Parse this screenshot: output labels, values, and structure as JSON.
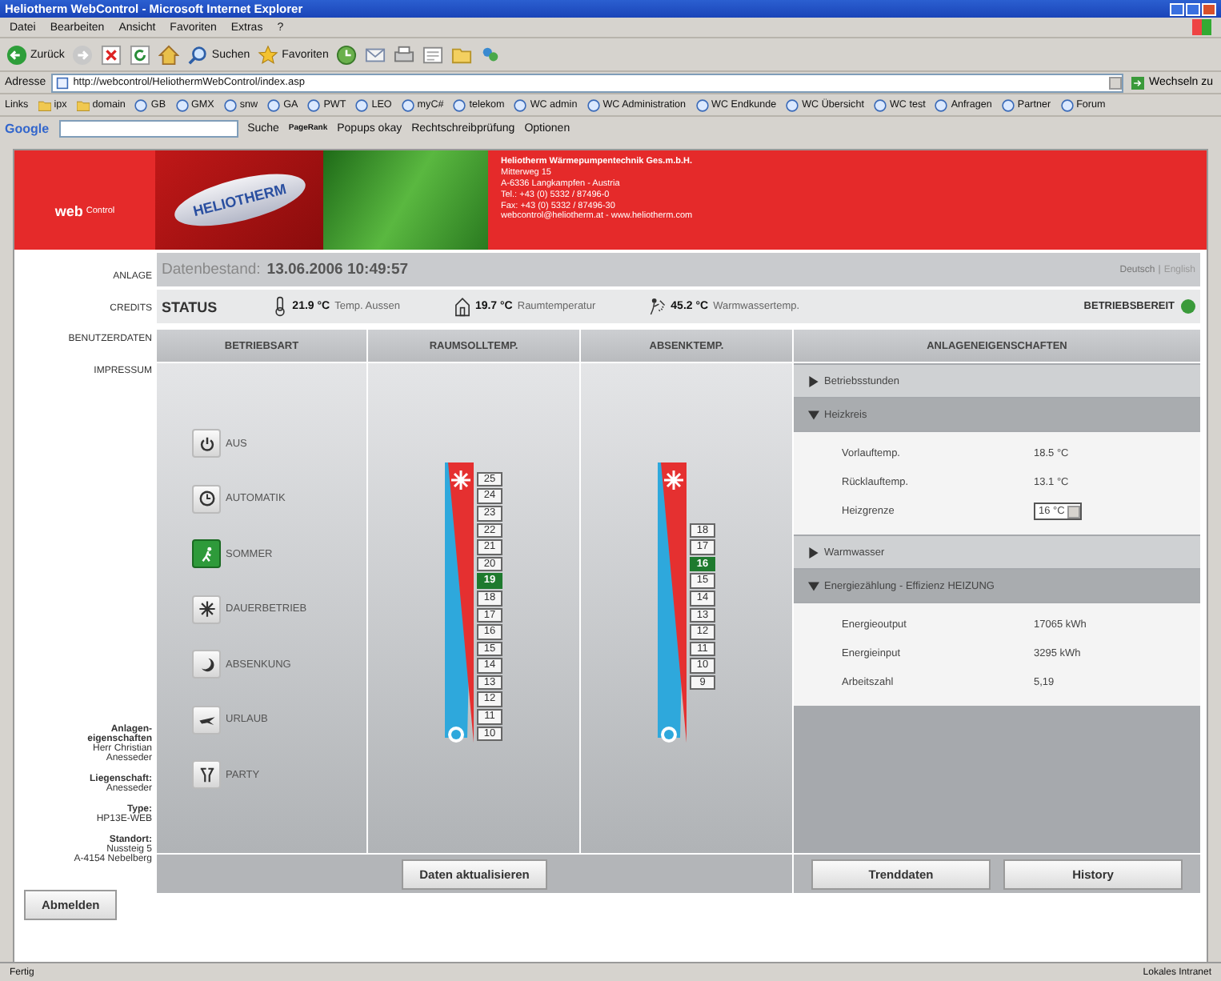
{
  "window": {
    "title": "Heliotherm WebControl - Microsoft Internet Explorer"
  },
  "menu": [
    "Datei",
    "Bearbeiten",
    "Ansicht",
    "Favoriten",
    "Extras",
    "?"
  ],
  "toolbar": {
    "back": "Zurück",
    "search": "Suchen",
    "favorites": "Favoriten"
  },
  "address": {
    "label": "Adresse",
    "url": "http://webcontrol/HeliothermWebControl/index.asp",
    "go": "Wechseln zu"
  },
  "links": {
    "label": "Links",
    "items": [
      {
        "label": "ipx",
        "kind": "folder"
      },
      {
        "label": "domain",
        "kind": "folder"
      },
      {
        "label": "GB",
        "kind": "page"
      },
      {
        "label": "GMX",
        "kind": "page"
      },
      {
        "label": "snw",
        "kind": "page"
      },
      {
        "label": "GA",
        "kind": "page"
      },
      {
        "label": "PWT",
        "kind": "page"
      },
      {
        "label": "LEO",
        "kind": "page"
      },
      {
        "label": "myC#",
        "kind": "page"
      },
      {
        "label": "telekom",
        "kind": "page"
      },
      {
        "label": "WC admin",
        "kind": "page"
      },
      {
        "label": "WC Administration",
        "kind": "page"
      },
      {
        "label": "WC Endkunde",
        "kind": "page"
      },
      {
        "label": "WC Übersicht",
        "kind": "page"
      },
      {
        "label": "WC test",
        "kind": "page"
      },
      {
        "label": "Anfragen",
        "kind": "page"
      },
      {
        "label": "Partner",
        "kind": "page"
      },
      {
        "label": "Forum",
        "kind": "page"
      }
    ]
  },
  "google": {
    "logo": "Google",
    "search": "Suche",
    "pagerank": "PageRank",
    "popups": "Popups okay",
    "spell": "Rechtschreibprüfung",
    "options": "Optionen"
  },
  "banner": {
    "product": "web",
    "product_suffix": "Control",
    "logo": "HELIOTHERM",
    "company": "Heliotherm Wärmepumpentechnik Ges.m.b.H.",
    "lines": [
      "Mitterweg 15",
      "A-6336 Langkampfen - Austria",
      "Tel.: +43 (0) 5332 / 87496-0",
      "Fax: +43 (0) 5332 / 87496-30",
      "webcontrol@heliotherm.at - www.heliotherm.com"
    ]
  },
  "sidebar": {
    "nav": [
      "ANLAGE",
      "CREDITS",
      "BENUTZERDATEN",
      "IMPRESSUM"
    ],
    "info": [
      {
        "label": "Anlagen-eigenschaften",
        "lines": [
          "Herr Christian",
          "Anesseder"
        ]
      },
      {
        "label": "Liegenschaft:",
        "lines": [
          "Anesseder"
        ]
      },
      {
        "label": "Type:",
        "lines": [
          "HP13E-WEB"
        ]
      },
      {
        "label": "Standort:",
        "lines": [
          "Nussteig 5",
          "A-4154 Nebelberg"
        ]
      }
    ],
    "logout": "Abmelden"
  },
  "datenbestand": {
    "label": "Datenbestand:",
    "value": "13.06.2006 10:49:57",
    "languages": [
      {
        "label": "Deutsch",
        "selected": true
      },
      {
        "label": "English",
        "selected": false
      }
    ],
    "separator": "|"
  },
  "status": {
    "title": "STATUS",
    "readings": [
      {
        "kind": "outdoor",
        "value": "21.9 °C",
        "label": "Temp. Aussen"
      },
      {
        "kind": "room",
        "value": "19.7 °C",
        "label": "Raumtemperatur"
      },
      {
        "kind": "water",
        "value": "45.2 °C",
        "label": "Warmwassertemp."
      }
    ],
    "state": "BETRIEBSBEREIT",
    "ok": true
  },
  "columns": [
    "BETRIEBSART",
    "RAUMSOLLTEMP.",
    "ABSENKTEMP.",
    "ANLAGENEIGENSCHAFTEN"
  ],
  "modes": [
    {
      "kind": "power",
      "label": "AUS",
      "selected": false
    },
    {
      "kind": "clock",
      "label": "AUTOMATIK",
      "selected": false
    },
    {
      "kind": "summer",
      "label": "SOMMER",
      "selected": true
    },
    {
      "kind": "star",
      "label": "DAUERBETRIEB",
      "selected": false
    },
    {
      "kind": "moon",
      "label": "ABSENKUNG",
      "selected": false
    },
    {
      "kind": "plane",
      "label": "URLAUB",
      "selected": false
    },
    {
      "kind": "party",
      "label": "PARTY",
      "selected": false
    }
  ],
  "raumsoll": [
    {
      "label": "25",
      "selected": false
    },
    {
      "label": "24",
      "selected": false
    },
    {
      "label": "23",
      "selected": false
    },
    {
      "label": "22",
      "selected": false
    },
    {
      "label": "21",
      "selected": false
    },
    {
      "label": "20",
      "selected": false
    },
    {
      "label": "19",
      "selected": true
    },
    {
      "label": "18",
      "selected": false
    },
    {
      "label": "17",
      "selected": false
    },
    {
      "label": "16",
      "selected": false
    },
    {
      "label": "15",
      "selected": false
    },
    {
      "label": "14",
      "selected": false
    },
    {
      "label": "13",
      "selected": false
    },
    {
      "label": "12",
      "selected": false
    },
    {
      "label": "11",
      "selected": false
    },
    {
      "label": "10",
      "selected": false
    }
  ],
  "absenk": [
    {
      "label": "18",
      "selected": false
    },
    {
      "label": "17",
      "selected": false
    },
    {
      "label": "16",
      "selected": true
    },
    {
      "label": "15",
      "selected": false
    },
    {
      "label": "14",
      "selected": false
    },
    {
      "label": "13",
      "selected": false
    },
    {
      "label": "12",
      "selected": false
    },
    {
      "label": "11",
      "selected": false
    },
    {
      "label": "10",
      "selected": false
    },
    {
      "label": "9",
      "selected": false
    }
  ],
  "sections": [
    {
      "title": "Betriebsstunden",
      "expanded": false
    },
    {
      "title": "Heizkreis",
      "expanded": true,
      "rows": [
        {
          "kind": "text",
          "label": "Vorlauftemp.",
          "value": "18.5 °C"
        },
        {
          "kind": "text",
          "label": "Rücklauftemp.",
          "value": "13.1 °C"
        },
        {
          "kind": "select",
          "label": "Heizgrenze",
          "value": "16 °C"
        }
      ]
    },
    {
      "title": "Warmwasser",
      "expanded": false
    },
    {
      "title": "Energiezählung - Effizienz HEIZUNG",
      "expanded": true,
      "rows": [
        {
          "kind": "text",
          "label": "Energieoutput",
          "value": "17065 kWh"
        },
        {
          "kind": "text",
          "label": "Energieinput",
          "value": "3295 kWh"
        },
        {
          "kind": "text",
          "label": "Arbeitszahl",
          "value": "5,19"
        }
      ]
    }
  ],
  "buttons": {
    "refresh": "Daten aktualisieren",
    "trend": "Trenddaten",
    "history": "History"
  },
  "status_bar": {
    "text": "Fertig",
    "zone": "Lokales Intranet"
  }
}
